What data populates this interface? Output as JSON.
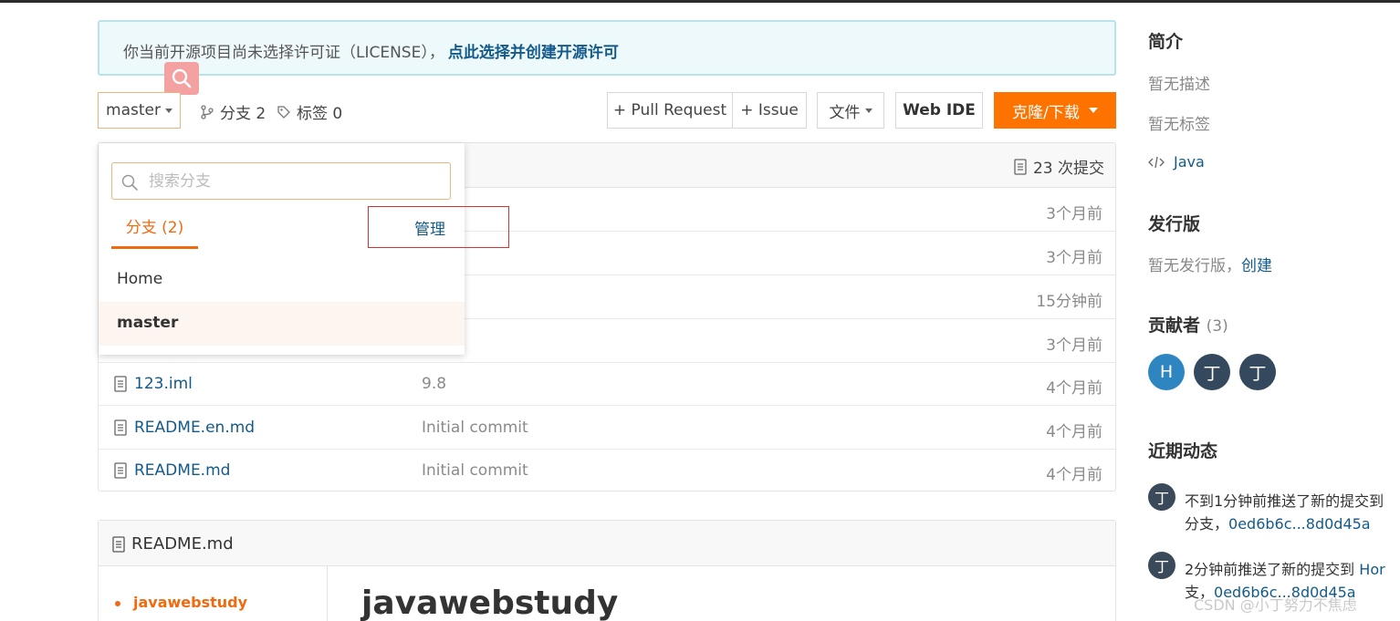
{
  "license_notice": {
    "text": "你当前开源项目尚未选择许可证（LICENSE），",
    "link": "点此选择并创建开源许可"
  },
  "toolbar": {
    "branch_label": "master",
    "branches_label": "分支 2",
    "tags_label": "标签 0",
    "pull_request": "+ Pull Request",
    "issue": "+ Issue",
    "file": "文件",
    "web_ide": "Web IDE",
    "clone": "克隆/下载"
  },
  "commits_label": "23 次提交",
  "file_rows": [
    {
      "name": "",
      "message": "",
      "time": "3个月前"
    },
    {
      "name": "",
      "message": "",
      "time": "3个月前"
    },
    {
      "name": "",
      "message": "",
      "time": "15分钟前"
    },
    {
      "name": "",
      "message": "",
      "time": "3个月前"
    },
    {
      "name": "123.iml",
      "message": "9.8",
      "time": "4个月前"
    },
    {
      "name": "README.en.md",
      "message": "Initial commit",
      "time": "4个月前"
    },
    {
      "name": "README.md",
      "message": "Initial commit",
      "time": "4个月前"
    }
  ],
  "branch_dropdown": {
    "search_placeholder": "搜索分支",
    "tab_label": "分支 (2)",
    "manage_label": "管理",
    "items": [
      "Home",
      "master"
    ]
  },
  "readme": {
    "title": "README.md",
    "toc_item": "javawebstudy",
    "heading": "javawebstudy"
  },
  "sidebar": {
    "intro_title": "简介",
    "no_description": "暂无描述",
    "no_tags": "暂无标签",
    "language": "Java",
    "release_title": "发行版",
    "no_release": "暂无发行版，",
    "create_link": "创建",
    "contributors_title": "贡献者",
    "contributors_count": "(3)",
    "contributors": [
      {
        "initial": "H",
        "color": "#2e86c1"
      },
      {
        "initial": "丁",
        "color": "#34495e"
      },
      {
        "initial": "丁",
        "color": "#34495e"
      }
    ],
    "activity_title": "近期动态",
    "activities": [
      {
        "avatar": "丁",
        "line1": "不到1分钟前推送了新的提交到",
        "line2": "分支，",
        "hash": "0ed6b6c...8d0d45a"
      },
      {
        "avatar": "丁",
        "line1": "2分钟前推送了新的提交到 ",
        "line1_link": "Hor",
        "line2": "支，",
        "hash": "0ed6b6c...8d0d45a"
      }
    ]
  },
  "watermark": "CSDN @小丁努力不焦虑",
  "colors": {
    "accent": "#fe7300",
    "link": "#135a8a",
    "highlight_box": "#d63232"
  }
}
